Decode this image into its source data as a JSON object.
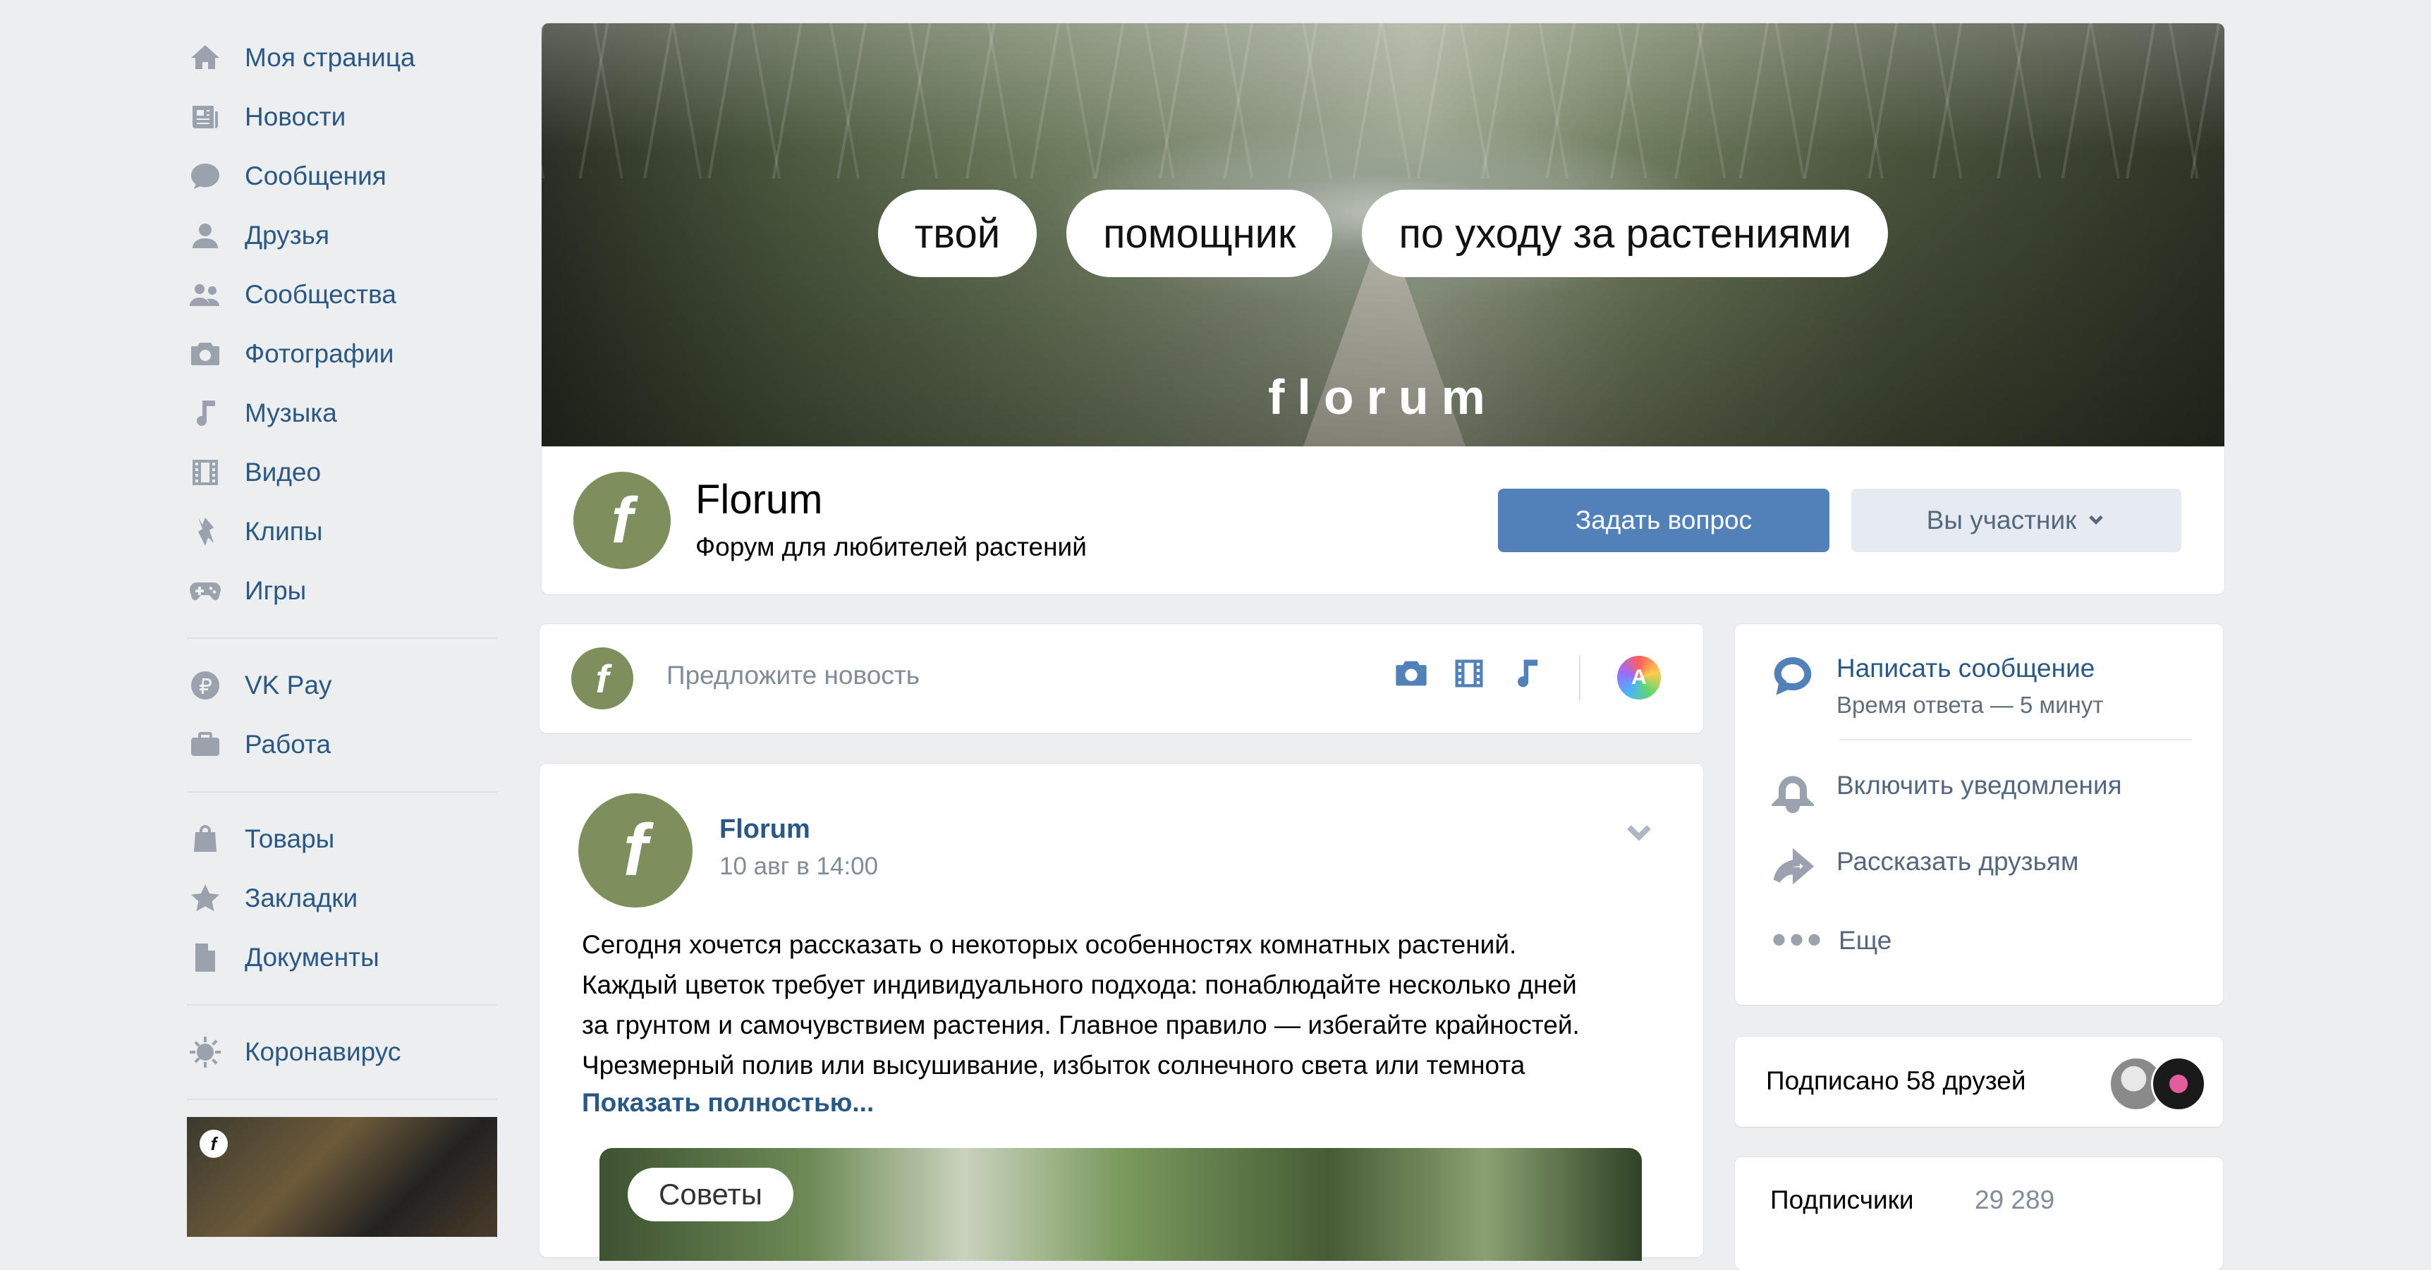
{
  "sidebar": {
    "items": [
      {
        "label": "Моя страница",
        "icon": "home-icon"
      },
      {
        "label": "Новости",
        "icon": "news-icon"
      },
      {
        "label": "Сообщения",
        "icon": "messages-icon"
      },
      {
        "label": "Друзья",
        "icon": "user-icon"
      },
      {
        "label": "Сообщества",
        "icon": "users-icon"
      },
      {
        "label": "Фотографии",
        "icon": "camera-icon"
      },
      {
        "label": "Музыка",
        "icon": "music-icon"
      },
      {
        "label": "Видео",
        "icon": "video-icon"
      },
      {
        "label": "Клипы",
        "icon": "clips-icon"
      },
      {
        "label": "Игры",
        "icon": "gamepad-icon"
      }
    ],
    "items2": [
      {
        "label": "VK Pay",
        "icon": "ruble-icon"
      },
      {
        "label": "Работа",
        "icon": "briefcase-icon"
      }
    ],
    "items3": [
      {
        "label": "Товары",
        "icon": "bag-icon"
      },
      {
        "label": "Закладки",
        "icon": "star-icon"
      },
      {
        "label": "Документы",
        "icon": "document-icon"
      }
    ],
    "items4": [
      {
        "label": "Коронавирус",
        "icon": "virus-icon"
      }
    ]
  },
  "cover": {
    "pills": [
      "твой",
      "помощник",
      "по уходу за растениями"
    ],
    "brand": "florum"
  },
  "group": {
    "name": "Florum",
    "subtitle": "Форум для любителей растений",
    "ask_button": "Задать вопрос",
    "member_button": "Вы участник",
    "avatar_letter": "f"
  },
  "suggest": {
    "placeholder": "Предложите новость",
    "art_letter": "A"
  },
  "post": {
    "author": "Florum",
    "date": "10 авг в 14:00",
    "lines": [
      "Сегодня хочется рассказать о некоторых особенностях комнатных растений.",
      "Каждый цветок требует индивидуального подхода: понаблюдайте несколько дней",
      "за грунтом и самочувствием растения. Главное правило — избегайте крайностей.",
      "Чрезмерный полив или высушивание, избыток солнечного света или темнота"
    ],
    "show_more": "Показать полностью...",
    "image_tag": "Советы"
  },
  "actions": {
    "message_title": "Написать сообщение",
    "message_sub": "Время ответа — 5 минут",
    "notify": "Включить уведомления",
    "share": "Рассказать друзьям",
    "more": "Еще"
  },
  "friends": {
    "text": "Подписано 58 друзей"
  },
  "subscribers": {
    "label": "Подписчики",
    "count": "29 289"
  },
  "colors": {
    "link": "#2a5885",
    "accent": "#5181b8",
    "background": "#edeef0",
    "group_avatar": "#7d8f5d"
  }
}
